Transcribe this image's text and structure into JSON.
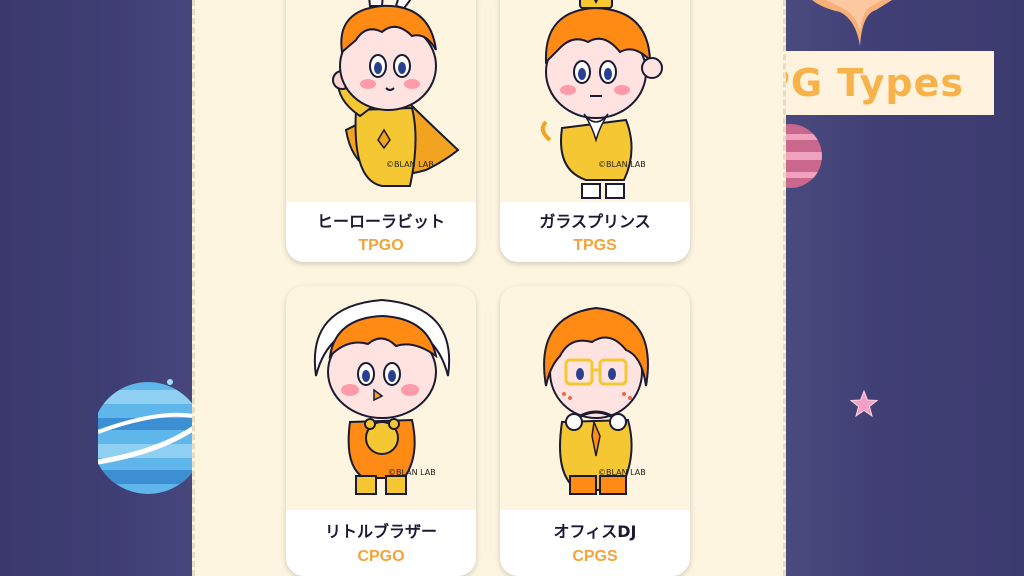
{
  "header": {
    "title": "PG Types"
  },
  "cards": [
    {
      "name": "ヒーローラビット",
      "code": "TPGO",
      "credit": "©BLAN LAB",
      "icon": "hero-rabbit-character-icon"
    },
    {
      "name": "ガラスプリンス",
      "code": "TPGS",
      "credit": "©BLAN LAB",
      "icon": "glass-prince-character-icon"
    },
    {
      "name": "リトルブラザー",
      "code": "CPGO",
      "credit": "©BLAN LAB",
      "icon": "little-brother-character-icon"
    },
    {
      "name": "オフィスDJ",
      "code": "CPGS",
      "credit": "©BLAN LAB",
      "icon": "office-dj-character-icon"
    }
  ],
  "colors": {
    "accent": "#f2a33a",
    "panel": "#fdf5df",
    "space": "#3e3d72"
  }
}
